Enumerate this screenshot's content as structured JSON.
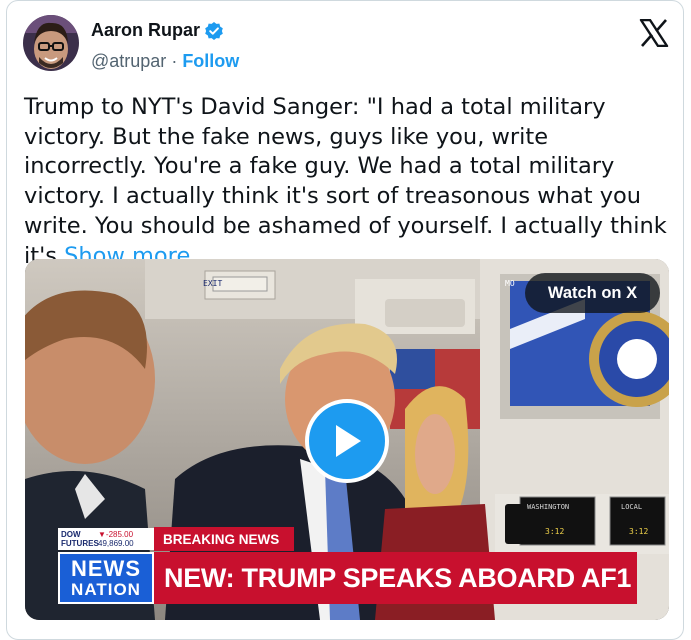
{
  "author": {
    "name": "Aaron Rupar",
    "handle": "@atrupar",
    "separator": "·",
    "follow_label": "Follow"
  },
  "tweet": {
    "text": "Trump to NYT's David Sanger: \"I had a total military victory. But the fake news, guys like you, write incorrectly. You're a fake guy. We had a total military victory. I actually think it's sort of treasonous what you write. You should be ashamed of yourself. I actually think it's ",
    "show_more_label": "Show more"
  },
  "media": {
    "watch_label": "Watch on X",
    "exit_sign": "EXIT",
    "screen_label": "MO",
    "sign_washington": "WASHINGTON",
    "sign_local": "LOCAL",
    "sign_time_left": "3:12",
    "sign_time_right": "3:12",
    "ticker": {
      "label_line1": "DOW",
      "label_line2": "FUTURES",
      "change": "▼-285.00",
      "value": "49,869.00"
    },
    "breaking_label": "BREAKING NEWS",
    "network_line1": "NEWS",
    "network_line2": "NATION",
    "headline": "NEW: TRUMP SPEAKS ABOARD AF1"
  },
  "icons": {
    "verified": "verified-badge-icon",
    "x_logo": "x-logo-icon",
    "play": "play-icon"
  },
  "colors": {
    "accent": "#1d9bf0",
    "text": "#0f1419",
    "muted": "#536471",
    "breaking_red": "#c8102e",
    "network_blue": "#1a5fd6"
  }
}
